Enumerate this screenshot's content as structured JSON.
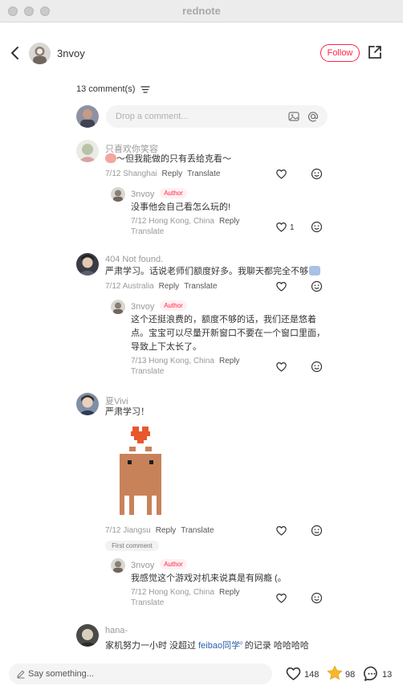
{
  "window": {
    "title": "rednote"
  },
  "header": {
    "author_name": "3nvoy",
    "follow_label": "Follow"
  },
  "comments_header": {
    "count_label": "13 comment(s)"
  },
  "comment_input": {
    "placeholder": "Drop a comment..."
  },
  "comments": [
    {
      "user": "只喜欢你笑容",
      "text": "～但我能做的只有丢给克看～",
      "date_location": "7/12 Shanghai",
      "reply_label": "Reply",
      "translate_label": "Translate",
      "replies": [
        {
          "user": "3nvoy",
          "badge": "Author",
          "text": "没事他会自己看怎么玩的!",
          "date_location": "7/12 Hong Kong, China",
          "reply_label": "Reply",
          "translate_label": "Translate",
          "likes": "1"
        }
      ]
    },
    {
      "user": "404 Not found.",
      "text": "严肃学习。话说老师们额度好多。我聊天都完全不够",
      "date_location": "7/12 Australia",
      "reply_label": "Reply",
      "translate_label": "Translate",
      "replies": [
        {
          "user": "3nvoy",
          "badge": "Author",
          "text_lines": [
            "这个还挺浪费的，额度不够的话，我们还是悠着",
            "点。宝宝可以尽量开新窗口不要在一个窗口里面，",
            "导致上下太长了。"
          ],
          "date_location": "7/13 Hong Kong, China",
          "reply_label": "Reply",
          "translate_label": "Translate"
        }
      ]
    },
    {
      "user": "夏Vivi",
      "text": "严肃学习！",
      "date_location": "7/12 Jiangsu",
      "reply_label": "Reply",
      "translate_label": "Translate",
      "first_badge": "First comment",
      "replies": [
        {
          "user": "3nvoy",
          "badge": "Author",
          "text": "我感觉这个游戏对机来说真是有网瘾 (。",
          "date_location": "7/12 Hong Kong, China",
          "reply_label": "Reply",
          "translate_label": "Translate"
        }
      ]
    },
    {
      "user": "hana-",
      "text_before": "家机努力一小时 没超过 ",
      "mention": "feibao同学",
      "text_after": " 的记录 哈哈哈哈"
    }
  ],
  "bottom_bar": {
    "placeholder": "Say something...",
    "likes": "148",
    "stars": "98",
    "comments": "13"
  },
  "colors": {
    "accent": "#ff2442",
    "star": "#f5b82e",
    "mention": "#2d5ea8"
  }
}
